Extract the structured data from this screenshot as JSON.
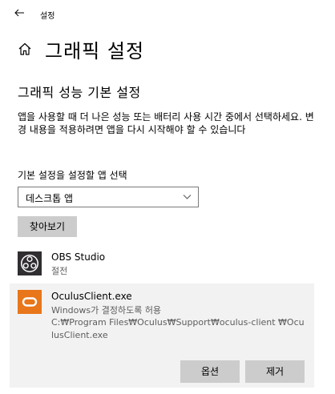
{
  "window": {
    "title": "설정"
  },
  "page": {
    "title": "그래픽 설정"
  },
  "section": {
    "title": "그래픽 성능 기본 설정",
    "description": "앱을 사용할 때 더 나은 성능 또는 배터리 사용 시간 중에서 선택하세요. 변경 내용을 적용하려면 앱을 다시 시작해야 할 수 있습니다"
  },
  "app_select": {
    "label": "기본 설정을 설정할 앱 선택",
    "value": "데스크톱 앱",
    "browse_label": "찾아보기"
  },
  "apps": [
    {
      "name": "OBS Studio",
      "status": "절전",
      "icon": "obs-studio-icon"
    },
    {
      "name": "OculusClient.exe",
      "status": "Windows가 결정하도록 허용",
      "path": "C:₩Program Files₩Oculus₩Support₩oculus-client ₩OculusClient.exe",
      "icon": "oculus-icon",
      "options_label": "옵션",
      "remove_label": "제거"
    }
  ],
  "icons": {
    "back": "back-arrow-icon",
    "home": "home-icon",
    "dropdown": "chevron-down-icon"
  },
  "colors": {
    "button_bg": "#cccccc",
    "selected_item_bg": "#f2f2f2",
    "oculus_brand": "#e8761a",
    "secondary_text": "#5d5d5d"
  }
}
